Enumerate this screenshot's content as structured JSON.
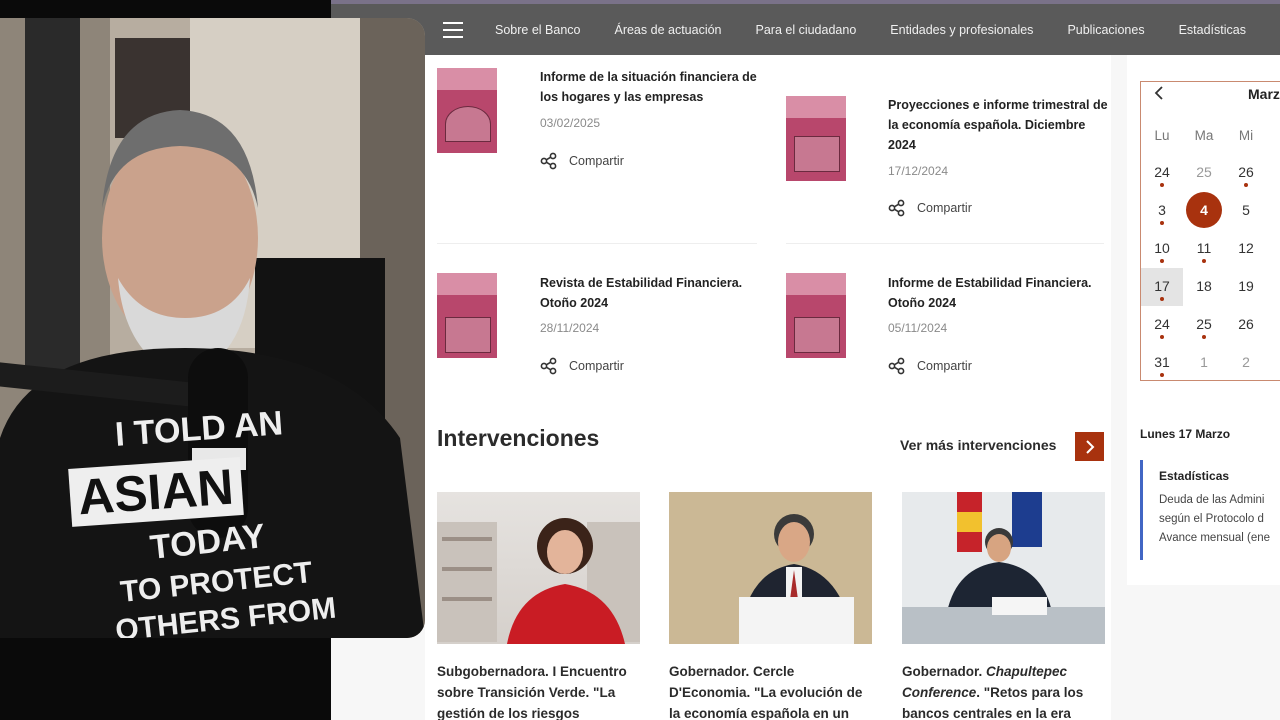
{
  "nav": {
    "items": [
      "Sobre el Banco",
      "Áreas de actuación",
      "Para el ciudadano",
      "Entidades y profesionales",
      "Publicaciones",
      "Estadísticas"
    ]
  },
  "publications": [
    {
      "title": "Informe de la situación financiera de los hogares y las empresas",
      "date": "03/02/2025",
      "share": "Compartir"
    },
    {
      "title": "Proyecciones e informe trimestral de la economía española. Diciembre 2024",
      "date": "17/12/2024",
      "share": "Compartir"
    },
    {
      "title": "Revista de Estabilidad Financiera. Otoño 2024",
      "date": "28/11/2024",
      "share": "Compartir"
    },
    {
      "title": "Informe de Estabilidad Financiera. Otoño 2024",
      "date": "05/11/2024",
      "share": "Compartir"
    }
  ],
  "interventions": {
    "title": "Intervenciones",
    "more": "Ver más intervenciones",
    "items": [
      {
        "lines": [
          "Subgobernadora. I Encuentro",
          "sobre Transición Verde. \"La",
          "gestión de los riesgos"
        ]
      },
      {
        "lines": [
          "Gobernador. Cercle",
          "D'Economia. \"La evolución de",
          "la economía española en un"
        ]
      },
      {
        "lines": [
          "Gobernador. ",
          "Chapultepec",
          "Conference",
          ". \"Retos para los",
          "bancos centrales en la era"
        ]
      }
    ]
  },
  "calendar": {
    "month": "Marz",
    "weekdays": [
      "Lu",
      "Ma",
      "Mi"
    ],
    "weeks": [
      [
        "24",
        "25",
        "26"
      ],
      [
        "3",
        "4",
        "5"
      ],
      [
        "10",
        "11",
        "12"
      ],
      [
        "17",
        "18",
        "19"
      ],
      [
        "24",
        "25",
        "26"
      ],
      [
        "31",
        "1",
        "2"
      ]
    ],
    "selected_date": "Lunes 17 Marzo",
    "event": {
      "category": "Estadísticas",
      "lines": [
        "Deuda de las Admini",
        "según el Protocolo d",
        "Avance mensual (ene"
      ]
    },
    "accent_color": "#a8320e"
  },
  "webcam_shirt": {
    "lines": [
      "I TOLD AN",
      "ASIAN",
      "TODAY",
      "TO PROTECT",
      "OTHERS FROM"
    ]
  }
}
